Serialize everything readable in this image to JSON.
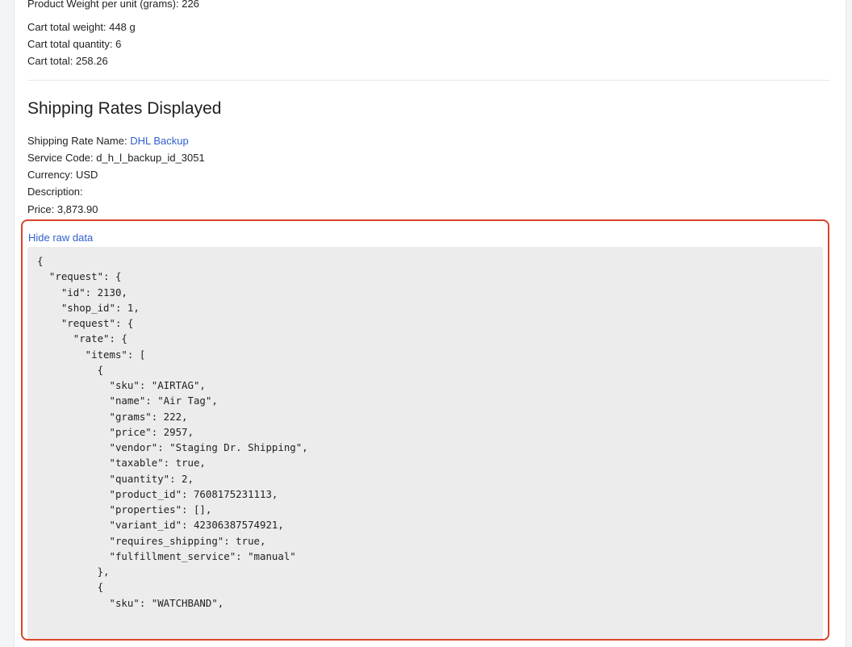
{
  "product": {
    "weight_per_unit_label": "Product Weight per unit (grams): 226"
  },
  "cart": {
    "total_weight": "Cart total weight: 448 g",
    "total_quantity": "Cart total quantity: 6",
    "total": "Cart total: 258.26"
  },
  "shipping": {
    "section_title": "Shipping Rates Displayed",
    "rate_name_label": "Shipping Rate Name: ",
    "rate_name_value": "DHL Backup",
    "service_code": "Service Code: d_h_l_backup_id_3051",
    "currency": "Currency: USD",
    "description": "Description:",
    "price": "Price: 3,873.90"
  },
  "raw_data": {
    "toggle_label": "Hide raw data",
    "json_text": "{\n  \"request\": {\n    \"id\": 2130,\n    \"shop_id\": 1,\n    \"request\": {\n      \"rate\": {\n        \"items\": [\n          {\n            \"sku\": \"AIRTAG\",\n            \"name\": \"Air Tag\",\n            \"grams\": 222,\n            \"price\": 2957,\n            \"vendor\": \"Staging Dr. Shipping\",\n            \"taxable\": true,\n            \"quantity\": 2,\n            \"product_id\": 7608175231113,\n            \"properties\": [],\n            \"variant_id\": 42306387574921,\n            \"requires_shipping\": true,\n            \"fulfillment_service\": \"manual\"\n          },\n          {\n            \"sku\": \"WATCHBAND\","
  },
  "colors": {
    "link": "#2f5fcc",
    "highlight_border": "#d9452b",
    "code_background": "#ececec"
  }
}
